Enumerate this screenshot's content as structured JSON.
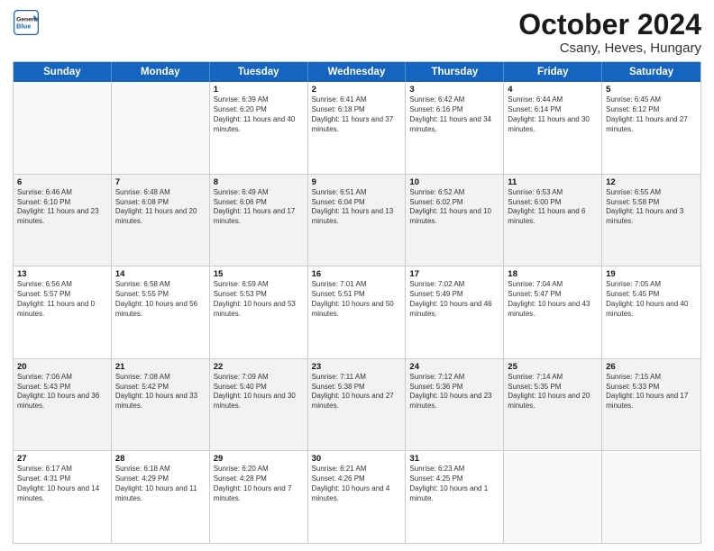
{
  "header": {
    "logo_line1": "General",
    "logo_line2": "Blue",
    "title": "October 2024",
    "subtitle": "Csany, Heves, Hungary"
  },
  "days_of_week": [
    "Sunday",
    "Monday",
    "Tuesday",
    "Wednesday",
    "Thursday",
    "Friday",
    "Saturday"
  ],
  "rows": [
    [
      {
        "day": "",
        "text": "",
        "empty": true
      },
      {
        "day": "",
        "text": "",
        "empty": true
      },
      {
        "day": "1",
        "text": "Sunrise: 6:39 AM\nSunset: 6:20 PM\nDaylight: 11 hours and 40 minutes."
      },
      {
        "day": "2",
        "text": "Sunrise: 6:41 AM\nSunset: 6:18 PM\nDaylight: 11 hours and 37 minutes."
      },
      {
        "day": "3",
        "text": "Sunrise: 6:42 AM\nSunset: 6:16 PM\nDaylight: 11 hours and 34 minutes."
      },
      {
        "day": "4",
        "text": "Sunrise: 6:44 AM\nSunset: 6:14 PM\nDaylight: 11 hours and 30 minutes."
      },
      {
        "day": "5",
        "text": "Sunrise: 6:45 AM\nSunset: 6:12 PM\nDaylight: 11 hours and 27 minutes."
      }
    ],
    [
      {
        "day": "6",
        "text": "Sunrise: 6:46 AM\nSunset: 6:10 PM\nDaylight: 11 hours and 23 minutes."
      },
      {
        "day": "7",
        "text": "Sunrise: 6:48 AM\nSunset: 6:08 PM\nDaylight: 11 hours and 20 minutes."
      },
      {
        "day": "8",
        "text": "Sunrise: 6:49 AM\nSunset: 6:06 PM\nDaylight: 11 hours and 17 minutes."
      },
      {
        "day": "9",
        "text": "Sunrise: 6:51 AM\nSunset: 6:04 PM\nDaylight: 11 hours and 13 minutes."
      },
      {
        "day": "10",
        "text": "Sunrise: 6:52 AM\nSunset: 6:02 PM\nDaylight: 11 hours and 10 minutes."
      },
      {
        "day": "11",
        "text": "Sunrise: 6:53 AM\nSunset: 6:00 PM\nDaylight: 11 hours and 6 minutes."
      },
      {
        "day": "12",
        "text": "Sunrise: 6:55 AM\nSunset: 5:58 PM\nDaylight: 11 hours and 3 minutes."
      }
    ],
    [
      {
        "day": "13",
        "text": "Sunrise: 6:56 AM\nSunset: 5:57 PM\nDaylight: 11 hours and 0 minutes."
      },
      {
        "day": "14",
        "text": "Sunrise: 6:58 AM\nSunset: 5:55 PM\nDaylight: 10 hours and 56 minutes."
      },
      {
        "day": "15",
        "text": "Sunrise: 6:59 AM\nSunset: 5:53 PM\nDaylight: 10 hours and 53 minutes."
      },
      {
        "day": "16",
        "text": "Sunrise: 7:01 AM\nSunset: 5:51 PM\nDaylight: 10 hours and 50 minutes."
      },
      {
        "day": "17",
        "text": "Sunrise: 7:02 AM\nSunset: 5:49 PM\nDaylight: 10 hours and 46 minutes."
      },
      {
        "day": "18",
        "text": "Sunrise: 7:04 AM\nSunset: 5:47 PM\nDaylight: 10 hours and 43 minutes."
      },
      {
        "day": "19",
        "text": "Sunrise: 7:05 AM\nSunset: 5:45 PM\nDaylight: 10 hours and 40 minutes."
      }
    ],
    [
      {
        "day": "20",
        "text": "Sunrise: 7:06 AM\nSunset: 5:43 PM\nDaylight: 10 hours and 36 minutes."
      },
      {
        "day": "21",
        "text": "Sunrise: 7:08 AM\nSunset: 5:42 PM\nDaylight: 10 hours and 33 minutes."
      },
      {
        "day": "22",
        "text": "Sunrise: 7:09 AM\nSunset: 5:40 PM\nDaylight: 10 hours and 30 minutes."
      },
      {
        "day": "23",
        "text": "Sunrise: 7:11 AM\nSunset: 5:38 PM\nDaylight: 10 hours and 27 minutes."
      },
      {
        "day": "24",
        "text": "Sunrise: 7:12 AM\nSunset: 5:36 PM\nDaylight: 10 hours and 23 minutes."
      },
      {
        "day": "25",
        "text": "Sunrise: 7:14 AM\nSunset: 5:35 PM\nDaylight: 10 hours and 20 minutes."
      },
      {
        "day": "26",
        "text": "Sunrise: 7:15 AM\nSunset: 5:33 PM\nDaylight: 10 hours and 17 minutes."
      }
    ],
    [
      {
        "day": "27",
        "text": "Sunrise: 6:17 AM\nSunset: 4:31 PM\nDaylight: 10 hours and 14 minutes."
      },
      {
        "day": "28",
        "text": "Sunrise: 6:18 AM\nSunset: 4:29 PM\nDaylight: 10 hours and 11 minutes."
      },
      {
        "day": "29",
        "text": "Sunrise: 6:20 AM\nSunset: 4:28 PM\nDaylight: 10 hours and 7 minutes."
      },
      {
        "day": "30",
        "text": "Sunrise: 6:21 AM\nSunset: 4:26 PM\nDaylight: 10 hours and 4 minutes."
      },
      {
        "day": "31",
        "text": "Sunrise: 6:23 AM\nSunset: 4:25 PM\nDaylight: 10 hours and 1 minute."
      },
      {
        "day": "",
        "text": "",
        "empty": true
      },
      {
        "day": "",
        "text": "",
        "empty": true
      }
    ]
  ]
}
